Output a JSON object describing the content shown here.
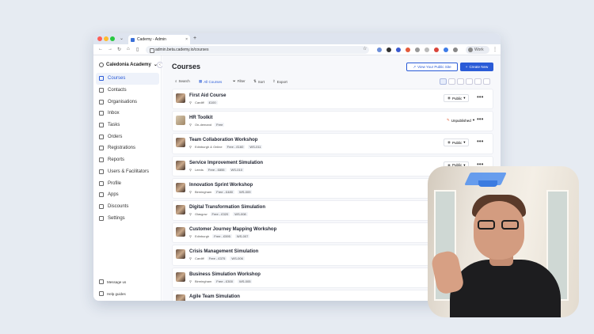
{
  "browser": {
    "tab_title": "Cademy - Admin",
    "url": "admin.beta.cademy.io/courses",
    "profile_label": "Work"
  },
  "sidebar": {
    "org_name": "Caledonia Academy",
    "items": [
      {
        "label": "Courses",
        "icon": "courses-icon"
      },
      {
        "label": "Contacts",
        "icon": "contacts-icon"
      },
      {
        "label": "Organisations",
        "icon": "organisations-icon"
      },
      {
        "label": "Inbox",
        "icon": "inbox-icon"
      },
      {
        "label": "Tasks",
        "icon": "tasks-icon"
      },
      {
        "label": "Orders",
        "icon": "orders-icon"
      },
      {
        "label": "Registrations",
        "icon": "registrations-icon"
      },
      {
        "label": "Reports",
        "icon": "reports-icon"
      },
      {
        "label": "Users & Facilitators",
        "icon": "users-icon"
      },
      {
        "label": "Profile",
        "icon": "profile-icon"
      },
      {
        "label": "Apps",
        "icon": "apps-icon"
      },
      {
        "label": "Discounts",
        "icon": "discounts-icon"
      },
      {
        "label": "Settings",
        "icon": "settings-icon"
      }
    ],
    "footer": {
      "message_us": "Message us",
      "help_guides": "Help guides"
    }
  },
  "header": {
    "title": "Courses",
    "view_site_label": "View Your Public Site",
    "create_label": "Create New"
  },
  "toolbar": {
    "search": "Search",
    "all_courses": "All Courses",
    "filter": "Filter",
    "sort": "Sort",
    "export": "Export"
  },
  "courses": [
    {
      "title": "First Aid Course",
      "meta": [
        "Cardiff",
        "£100"
      ],
      "status": "Public"
    },
    {
      "title": "HR Toolkit",
      "meta": [
        "On-demand",
        "Free"
      ],
      "status": "Unpublished"
    },
    {
      "title": "Team Collaboration Workshop",
      "meta": [
        "Edinburgh & Online",
        "Free - £160",
        "WS-011"
      ],
      "status": "Public"
    },
    {
      "title": "Service Improvement Simulation",
      "meta": [
        "Leeds",
        "Free - £855",
        "WS-010"
      ],
      "status": "Public"
    },
    {
      "title": "Innovation Sprint Workshop",
      "meta": [
        "Birmingham",
        "Free - £480",
        "WS-009"
      ],
      "status": ""
    },
    {
      "title": "Digital Transformation Simulation",
      "meta": [
        "Glasgow",
        "Free - £320",
        "WS-008"
      ],
      "status": ""
    },
    {
      "title": "Customer Journey Mapping Workshop",
      "meta": [
        "Edinburgh",
        "Free - £595",
        "WS-007"
      ],
      "status": ""
    },
    {
      "title": "Crisis Management Simulation",
      "meta": [
        "Cardiff",
        "Free - £375",
        "WS-006"
      ],
      "status": ""
    },
    {
      "title": "Business Simulation Workshop",
      "meta": [
        "Birmingham",
        "Free - £300",
        "WS-005"
      ],
      "status": ""
    },
    {
      "title": "Agile Team Simulation",
      "meta": [],
      "status": ""
    }
  ],
  "colors": {
    "accent": "#2a5bd7",
    "unpublished": "#e0552b"
  }
}
